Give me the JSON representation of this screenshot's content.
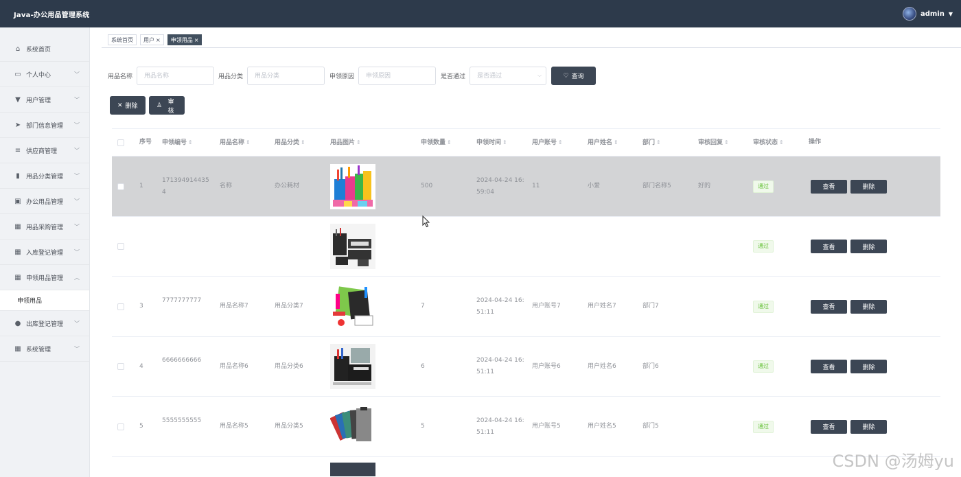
{
  "header": {
    "title": "Java-办公用品管理系统",
    "username": "admin"
  },
  "sidebar": {
    "items": [
      {
        "label": "系统首页",
        "icon": "home-icon",
        "glyph": "⌂",
        "chevron": false
      },
      {
        "label": "个人中心",
        "icon": "calendar-icon",
        "glyph": "▭",
        "chevron": true
      },
      {
        "label": "用户管理",
        "icon": "user-icon",
        "glyph": "▼",
        "chevron": true
      },
      {
        "label": "部门信息管理",
        "icon": "send-icon",
        "glyph": "➤",
        "chevron": true
      },
      {
        "label": "供应商管理",
        "icon": "sliders-icon",
        "glyph": "≡",
        "chevron": true
      },
      {
        "label": "用品分类管理",
        "icon": "bar-chart-icon",
        "glyph": "▮",
        "chevron": true
      },
      {
        "label": "办公用品管理",
        "icon": "clipboard-icon",
        "glyph": "▣",
        "chevron": true
      },
      {
        "label": "用品采购管理",
        "icon": "grid-icon",
        "glyph": "▦",
        "chevron": true
      },
      {
        "label": "入库登记管理",
        "icon": "grid-icon",
        "glyph": "▦",
        "chevron": true
      },
      {
        "label": "申领用品管理",
        "icon": "grid-icon",
        "glyph": "▦",
        "chevron": true,
        "expanded": true
      }
    ],
    "sub_item": "申领用品",
    "items_after": [
      {
        "label": "出库登记管理",
        "icon": "location-icon",
        "glyph": "●",
        "chevron": true
      },
      {
        "label": "系统管理",
        "icon": "grid-icon",
        "glyph": "▦",
        "chevron": true
      }
    ]
  },
  "tabs": [
    {
      "label": "系统首页",
      "closable": false,
      "active": false
    },
    {
      "label": "用户",
      "closable": true,
      "active": false
    },
    {
      "label": "申领用品",
      "closable": true,
      "active": true
    }
  ],
  "search": {
    "name_label": "用品名称",
    "name_placeholder": "用品名称",
    "category_label": "用品分类",
    "category_placeholder": "用品分类",
    "reason_label": "申领原因",
    "reason_placeholder": "申领原因",
    "approved_label": "是否通过",
    "approved_placeholder": "是否通过",
    "query_button": "查询"
  },
  "actions": {
    "delete_label": "删除",
    "review_label": "审核"
  },
  "table": {
    "headers": [
      "序号",
      "申领编号",
      "用品名称",
      "用品分类",
      "用品图片",
      "申领数量",
      "申领时间",
      "用户账号",
      "用户姓名",
      "部门",
      "审核回复",
      "审核状态",
      "操作"
    ],
    "view_label": "查看",
    "delete_label": "删除",
    "rows": [
      {
        "idx": "1",
        "code_1": "171394914435",
        "code_2": "4",
        "name": "名称",
        "category": "办公耗材",
        "qty": "500",
        "time_1": "2024-04-24 16:",
        "time_2": "59:04",
        "account": "11",
        "username": "小爱",
        "dept": "部门名称5",
        "reply": "好的",
        "status": "通过",
        "highlight": true,
        "image": "pens"
      },
      {
        "idx": "",
        "code_1": "",
        "code_2": "",
        "name": "",
        "category": "",
        "qty": "",
        "time_1": "",
        "time_2": "",
        "account": "",
        "username": "",
        "dept": "",
        "reply": "",
        "status": "通过",
        "highlight": false,
        "image": "organizer"
      },
      {
        "idx": "3",
        "code_1": "7777777777",
        "code_2": "",
        "name": "用品名称7",
        "category": "用品分类7",
        "qty": "7",
        "time_1": "2024-04-24 16:",
        "time_2": "51:11",
        "account": "用户账号7",
        "username": "用户姓名7",
        "dept": "部门7",
        "reply": "",
        "status": "通过",
        "highlight": false,
        "image": "stationery"
      },
      {
        "idx": "4",
        "code_1": "6666666666",
        "code_2": "",
        "name": "用品名称6",
        "category": "用品分类6",
        "qty": "6",
        "time_1": "2024-04-24 16:",
        "time_2": "51:11",
        "account": "用户账号6",
        "username": "用户姓名6",
        "dept": "部门6",
        "reply": "",
        "status": "通过",
        "highlight": false,
        "image": "desk-set"
      },
      {
        "idx": "5",
        "code_1": "5555555555",
        "code_2": "",
        "name": "用品名称5",
        "category": "用品分类5",
        "qty": "5",
        "time_1": "2024-04-24 16:",
        "time_2": "51:11",
        "account": "用户账号5",
        "username": "用户姓名5",
        "dept": "部门5",
        "reply": "",
        "status": "通过",
        "highlight": false,
        "image": "clipboards"
      }
    ]
  },
  "watermark": "CSDN @汤姆yu"
}
